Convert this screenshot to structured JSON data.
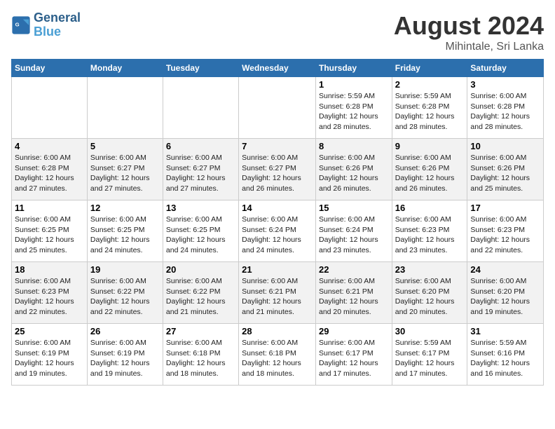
{
  "header": {
    "logo_line1": "General",
    "logo_line2": "Blue",
    "month_year": "August 2024",
    "location": "Mihintale, Sri Lanka"
  },
  "days_of_week": [
    "Sunday",
    "Monday",
    "Tuesday",
    "Wednesday",
    "Thursday",
    "Friday",
    "Saturday"
  ],
  "weeks": [
    [
      {
        "day": "",
        "info": ""
      },
      {
        "day": "",
        "info": ""
      },
      {
        "day": "",
        "info": ""
      },
      {
        "day": "",
        "info": ""
      },
      {
        "day": "1",
        "info": "Sunrise: 5:59 AM\nSunset: 6:28 PM\nDaylight: 12 hours\nand 28 minutes."
      },
      {
        "day": "2",
        "info": "Sunrise: 5:59 AM\nSunset: 6:28 PM\nDaylight: 12 hours\nand 28 minutes."
      },
      {
        "day": "3",
        "info": "Sunrise: 6:00 AM\nSunset: 6:28 PM\nDaylight: 12 hours\nand 28 minutes."
      }
    ],
    [
      {
        "day": "4",
        "info": "Sunrise: 6:00 AM\nSunset: 6:28 PM\nDaylight: 12 hours\nand 27 minutes."
      },
      {
        "day": "5",
        "info": "Sunrise: 6:00 AM\nSunset: 6:27 PM\nDaylight: 12 hours\nand 27 minutes."
      },
      {
        "day": "6",
        "info": "Sunrise: 6:00 AM\nSunset: 6:27 PM\nDaylight: 12 hours\nand 27 minutes."
      },
      {
        "day": "7",
        "info": "Sunrise: 6:00 AM\nSunset: 6:27 PM\nDaylight: 12 hours\nand 26 minutes."
      },
      {
        "day": "8",
        "info": "Sunrise: 6:00 AM\nSunset: 6:26 PM\nDaylight: 12 hours\nand 26 minutes."
      },
      {
        "day": "9",
        "info": "Sunrise: 6:00 AM\nSunset: 6:26 PM\nDaylight: 12 hours\nand 26 minutes."
      },
      {
        "day": "10",
        "info": "Sunrise: 6:00 AM\nSunset: 6:26 PM\nDaylight: 12 hours\nand 25 minutes."
      }
    ],
    [
      {
        "day": "11",
        "info": "Sunrise: 6:00 AM\nSunset: 6:25 PM\nDaylight: 12 hours\nand 25 minutes."
      },
      {
        "day": "12",
        "info": "Sunrise: 6:00 AM\nSunset: 6:25 PM\nDaylight: 12 hours\nand 24 minutes."
      },
      {
        "day": "13",
        "info": "Sunrise: 6:00 AM\nSunset: 6:25 PM\nDaylight: 12 hours\nand 24 minutes."
      },
      {
        "day": "14",
        "info": "Sunrise: 6:00 AM\nSunset: 6:24 PM\nDaylight: 12 hours\nand 24 minutes."
      },
      {
        "day": "15",
        "info": "Sunrise: 6:00 AM\nSunset: 6:24 PM\nDaylight: 12 hours\nand 23 minutes."
      },
      {
        "day": "16",
        "info": "Sunrise: 6:00 AM\nSunset: 6:23 PM\nDaylight: 12 hours\nand 23 minutes."
      },
      {
        "day": "17",
        "info": "Sunrise: 6:00 AM\nSunset: 6:23 PM\nDaylight: 12 hours\nand 22 minutes."
      }
    ],
    [
      {
        "day": "18",
        "info": "Sunrise: 6:00 AM\nSunset: 6:23 PM\nDaylight: 12 hours\nand 22 minutes."
      },
      {
        "day": "19",
        "info": "Sunrise: 6:00 AM\nSunset: 6:22 PM\nDaylight: 12 hours\nand 22 minutes."
      },
      {
        "day": "20",
        "info": "Sunrise: 6:00 AM\nSunset: 6:22 PM\nDaylight: 12 hours\nand 21 minutes."
      },
      {
        "day": "21",
        "info": "Sunrise: 6:00 AM\nSunset: 6:21 PM\nDaylight: 12 hours\nand 21 minutes."
      },
      {
        "day": "22",
        "info": "Sunrise: 6:00 AM\nSunset: 6:21 PM\nDaylight: 12 hours\nand 20 minutes."
      },
      {
        "day": "23",
        "info": "Sunrise: 6:00 AM\nSunset: 6:20 PM\nDaylight: 12 hours\nand 20 minutes."
      },
      {
        "day": "24",
        "info": "Sunrise: 6:00 AM\nSunset: 6:20 PM\nDaylight: 12 hours\nand 19 minutes."
      }
    ],
    [
      {
        "day": "25",
        "info": "Sunrise: 6:00 AM\nSunset: 6:19 PM\nDaylight: 12 hours\nand 19 minutes."
      },
      {
        "day": "26",
        "info": "Sunrise: 6:00 AM\nSunset: 6:19 PM\nDaylight: 12 hours\nand 19 minutes."
      },
      {
        "day": "27",
        "info": "Sunrise: 6:00 AM\nSunset: 6:18 PM\nDaylight: 12 hours\nand 18 minutes."
      },
      {
        "day": "28",
        "info": "Sunrise: 6:00 AM\nSunset: 6:18 PM\nDaylight: 12 hours\nand 18 minutes."
      },
      {
        "day": "29",
        "info": "Sunrise: 6:00 AM\nSunset: 6:17 PM\nDaylight: 12 hours\nand 17 minutes."
      },
      {
        "day": "30",
        "info": "Sunrise: 5:59 AM\nSunset: 6:17 PM\nDaylight: 12 hours\nand 17 minutes."
      },
      {
        "day": "31",
        "info": "Sunrise: 5:59 AM\nSunset: 6:16 PM\nDaylight: 12 hours\nand 16 minutes."
      }
    ]
  ]
}
